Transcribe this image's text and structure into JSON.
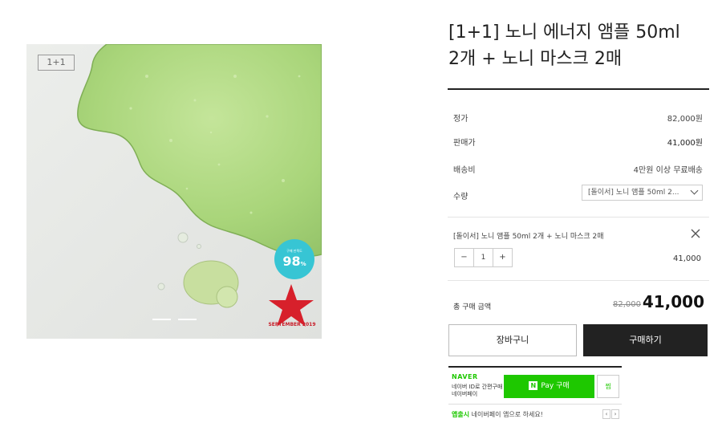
{
  "gallery": {
    "badge": "1+1",
    "score_value": "98",
    "score_unit": "%",
    "score_label": "구매 만족도",
    "stamp_text": "SEPTEMBER 2019",
    "accent_colors": {
      "gel": "#a9d57a",
      "score": "#37c5d4",
      "star": "#d7202b"
    }
  },
  "product": {
    "title_line1": "[1+1] 노니 에너지 앰플 50ml",
    "title_line2": "2개 + 노니 마스크 2매"
  },
  "info": {
    "list_price_label": "정가",
    "list_price": "82,000원",
    "sale_price_label": "판매가",
    "sale_price": "41,000원",
    "shipping_label": "배송비",
    "shipping": "4만원 이상 무료배송",
    "quantity_label": "수량",
    "option_selected": "[돌이서] 노니 앰플 50ml 2..."
  },
  "selection": {
    "item_name": "[돌이서] 노니 앰플 50ml 2개 + 노니 마스크 2매",
    "quantity": "1",
    "minus": "−",
    "plus": "+",
    "line_price": "41,000"
  },
  "total": {
    "label": "총 구매 금액",
    "original": "82,000",
    "final": "41,000"
  },
  "actions": {
    "cart": "장바구니",
    "buy": "구매하기"
  },
  "naverpay": {
    "brand": "NAVER",
    "sub1": "네이버 ID로 간편구매",
    "sub2": "네이버페이",
    "pay_n": "N",
    "pay_label": "Pay 구매",
    "wish": "찜",
    "promo_strong": "앱출시",
    "promo_text": " 네이버페이 앱으로 하세요!",
    "prev": "‹",
    "next": "›",
    "brand_color": "#1ec800"
  }
}
